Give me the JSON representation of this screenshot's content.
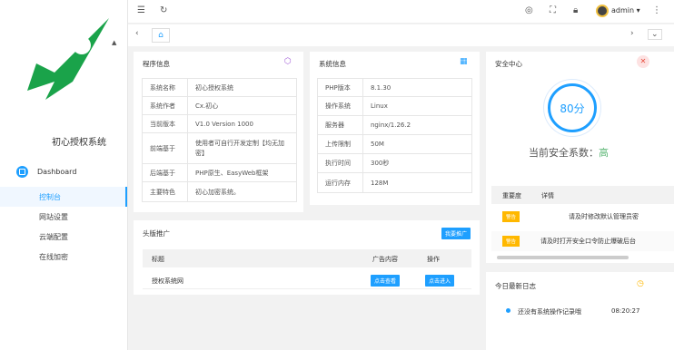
{
  "app": {
    "title": "初心授权系统"
  },
  "sidebar": {
    "group": "Dashboard",
    "items": [
      {
        "label": "控制台"
      },
      {
        "label": "网站设置"
      },
      {
        "label": "云端配置"
      },
      {
        "label": "在线加密"
      }
    ]
  },
  "header": {
    "user": "admin"
  },
  "program": {
    "title": "程序信息",
    "rows": [
      {
        "k": "系统名称",
        "v": "初心授权系统"
      },
      {
        "k": "系统作者",
        "v": "Cx.初心"
      },
      {
        "k": "当前版本",
        "v": "V1.0 Version 1000"
      },
      {
        "k": "前端基于",
        "v": "使用者可自行开发定制【均无加密】"
      },
      {
        "k": "后端基于",
        "v": "PHP原生、EasyWeb框架"
      },
      {
        "k": "主要特色",
        "v": "初心加密系统。"
      }
    ]
  },
  "system": {
    "title": "系统信息",
    "rows": [
      {
        "k": "PHP版本",
        "v": "8.1.30"
      },
      {
        "k": "操作系统",
        "v": "Linux"
      },
      {
        "k": "服务器",
        "v": "nginx/1.26.2"
      },
      {
        "k": "上传限制",
        "v": "50M"
      },
      {
        "k": "执行时间",
        "v": "300秒"
      },
      {
        "k": "运行内存",
        "v": "128M"
      }
    ]
  },
  "security": {
    "title": "安全中心",
    "score": "80分",
    "level_label": "当前安全系数：",
    "level_value": "高",
    "col_level": "重要度",
    "col_detail": "详情",
    "items": [
      {
        "badge": "警告",
        "text": "请及时修改默认管理员密"
      },
      {
        "badge": "警告",
        "text": "请及时打开安全口令防止爆破后台"
      }
    ]
  },
  "promo": {
    "title": "头版推广",
    "button": "我要推广",
    "col_title": "标题",
    "col_content": "广告内容",
    "col_action": "操作",
    "row": {
      "title": "授权系统网",
      "view": "点击查看",
      "enter": "点击进入"
    }
  },
  "log": {
    "title": "今日最新日志",
    "entry": "还没有系统操作记录哦",
    "time": "08:20:27"
  },
  "colors": {
    "accent": "#1E9FFF",
    "warn": "#FFB800",
    "good": "#5FB878"
  }
}
